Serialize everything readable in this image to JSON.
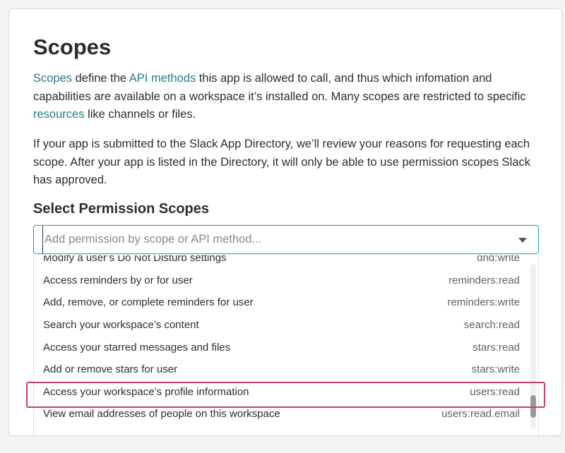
{
  "page": {
    "title": "Scopes",
    "intro": {
      "link_scopes": "Scopes",
      "text_1": " define the ",
      "link_api_methods": "API methods",
      "text_2": " this app is allowed to call, and thus which infomation and capabilities are available on a workspace it’s installed on. Many scopes are restricted to specific ",
      "link_resources": "resources",
      "text_3": " like channels or files."
    },
    "review_text": "If your app is submitted to the Slack App Directory, we’ll review your reasons for requesting each scope. After your app is listed in the Directory, it will only be able to use permission scopes Slack has approved.",
    "section_title": "Select Permission Scopes"
  },
  "search": {
    "placeholder": "Add permission by scope or API method...",
    "value": ""
  },
  "options": [
    {
      "label": "Modify a user’s Do Not Disturb settings",
      "scope": "dnd:write"
    },
    {
      "label": "Access reminders by or for user",
      "scope": "reminders:read"
    },
    {
      "label": "Add, remove, or complete reminders for user",
      "scope": "reminders:write"
    },
    {
      "label": "Search your workspace’s content",
      "scope": "search:read"
    },
    {
      "label": "Access your starred messages and files",
      "scope": "stars:read"
    },
    {
      "label": "Add or remove stars for user",
      "scope": "stars:write"
    },
    {
      "label": "Access your workspace’s profile information",
      "scope": "users:read",
      "highlighted": true
    },
    {
      "label": "View email addresses of people on this workspace",
      "scope": "users:read.email"
    }
  ],
  "colors": {
    "link": "#2a7a8c",
    "focus_border": "#3ba0bd",
    "highlight_box": "#c9406f"
  }
}
